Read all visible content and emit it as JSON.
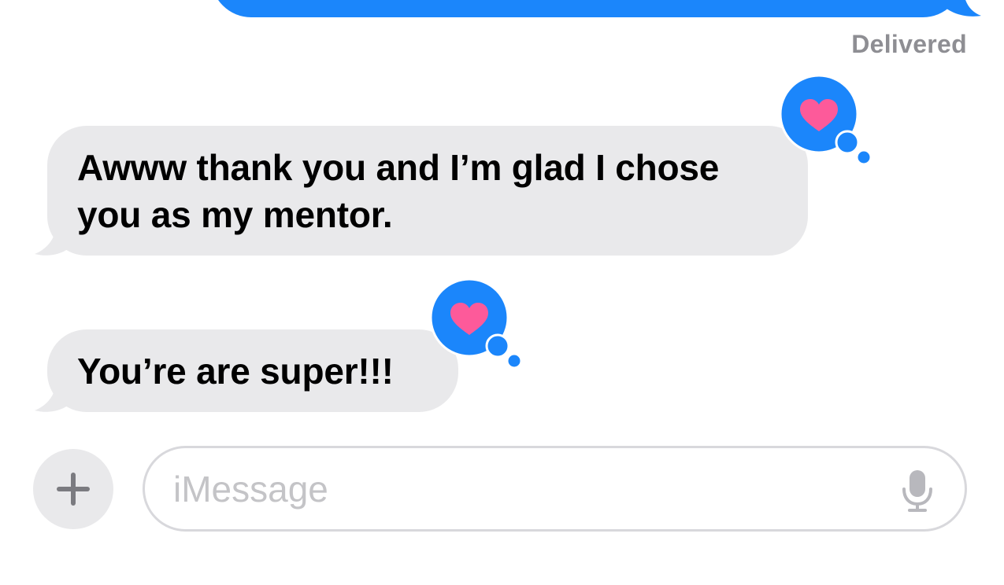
{
  "conversation": {
    "status": "Delivered",
    "messages": [
      {
        "text": "Awww thank you and I’m glad I chose you as my mentor.",
        "reaction": "heart"
      },
      {
        "text": "You’re are super!!!",
        "reaction": "heart"
      }
    ]
  },
  "composer": {
    "placeholder": "iMessage",
    "add_icon": "plus-icon",
    "mic_icon": "microphone-icon"
  },
  "colors": {
    "outgoing_bubble": "#1b86fb",
    "incoming_bubble": "#e9e9eb",
    "heart": "#fd5a9a",
    "status_text": "#8e8e93"
  }
}
